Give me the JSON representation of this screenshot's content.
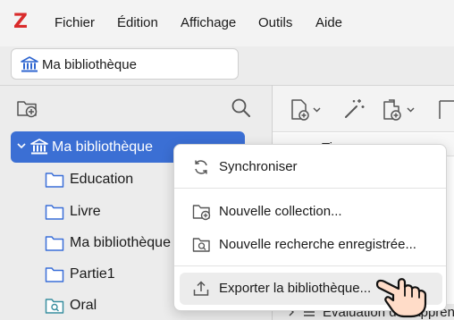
{
  "app": {
    "logo": "Z"
  },
  "menubar": {
    "items": [
      "Fichier",
      "Édition",
      "Affichage",
      "Outils",
      "Aide"
    ]
  },
  "library_tab": {
    "label": "Ma bibliothèque"
  },
  "collections": {
    "root": {
      "label": "Ma bibliothèque",
      "expanded": true,
      "selected": true
    },
    "children": [
      {
        "label": "Education",
        "icon": "folder-icon"
      },
      {
        "label": "Livre",
        "icon": "folder-icon"
      },
      {
        "label": "Ma bibliothèque",
        "icon": "folder-icon"
      },
      {
        "label": "Partie1",
        "icon": "folder-icon"
      },
      {
        "label": "Oral",
        "icon": "saved-search-folder-icon"
      }
    ]
  },
  "items_pane": {
    "column_header_fragment": "Ti",
    "last_row_text": "Evaluation de l'apprent"
  },
  "context_menu": {
    "items": [
      {
        "label": "Synchroniser",
        "icon": "sync-icon"
      },
      {
        "label": "Nouvelle collection...",
        "icon": "new-collection-icon"
      },
      {
        "label": "Nouvelle recherche enregistrée...",
        "icon": "new-saved-search-icon"
      },
      {
        "label": "Exporter la bibliothèque...",
        "icon": "export-icon",
        "hovered": true
      }
    ]
  },
  "colors": {
    "accent": "#3b6fd4",
    "logo": "#d92b2b",
    "folder": "#3a6fd8",
    "saved_search": "#3a8fa0"
  }
}
